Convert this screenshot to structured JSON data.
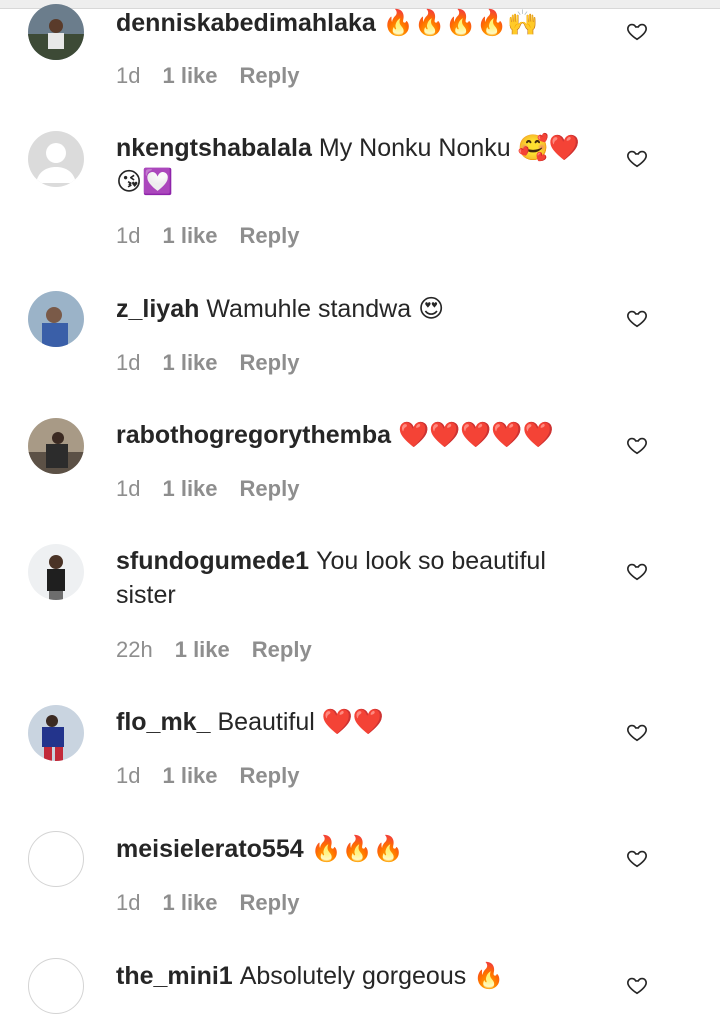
{
  "comments": [
    {
      "username": "denniskabedimahlaka",
      "text": "",
      "emoji": "🔥🔥🔥🔥🙌",
      "time": "1d",
      "likes": "1 like",
      "reply": "Reply",
      "avatar": "photo"
    },
    {
      "username": "nkengtshabalala",
      "text": "My Nonku Nonku",
      "emoji": "🥰❤️😘💟",
      "time": "1d",
      "likes": "1 like",
      "reply": "Reply",
      "avatar": "default"
    },
    {
      "username": "z_liyah",
      "text": "Wamuhle standwa",
      "emoji": "😍",
      "time": "1d",
      "likes": "1 like",
      "reply": "Reply",
      "avatar": "photo"
    },
    {
      "username": "rabothogregorythemba",
      "text": "",
      "emoji": "❤️❤️❤️❤️❤️",
      "time": "1d",
      "likes": "1 like",
      "reply": "Reply",
      "avatar": "photo"
    },
    {
      "username": "sfundogumede1",
      "text": "You look so beautiful sister",
      "emoji": "",
      "time": "22h",
      "likes": "1 like",
      "reply": "Reply",
      "avatar": "photo"
    },
    {
      "username": "flo_mk_",
      "text": "Beautiful",
      "emoji": "❤️❤️",
      "time": "1d",
      "likes": "1 like",
      "reply": "Reply",
      "avatar": "photo"
    },
    {
      "username": "meisielerato554",
      "text": "",
      "emoji": "🔥🔥🔥",
      "time": "1d",
      "likes": "1 like",
      "reply": "Reply",
      "avatar": "empty"
    },
    {
      "username": "the_mini1",
      "text": "Absolutely gorgeous",
      "emoji": "🔥",
      "time": "",
      "likes": "",
      "reply": "",
      "avatar": "empty"
    }
  ],
  "icons": {
    "like": "heart-outline-icon"
  },
  "colors": {
    "text": "#262626",
    "meta": "#8e8e8e",
    "fire": "#f25c05",
    "heart": "#e0245e"
  }
}
